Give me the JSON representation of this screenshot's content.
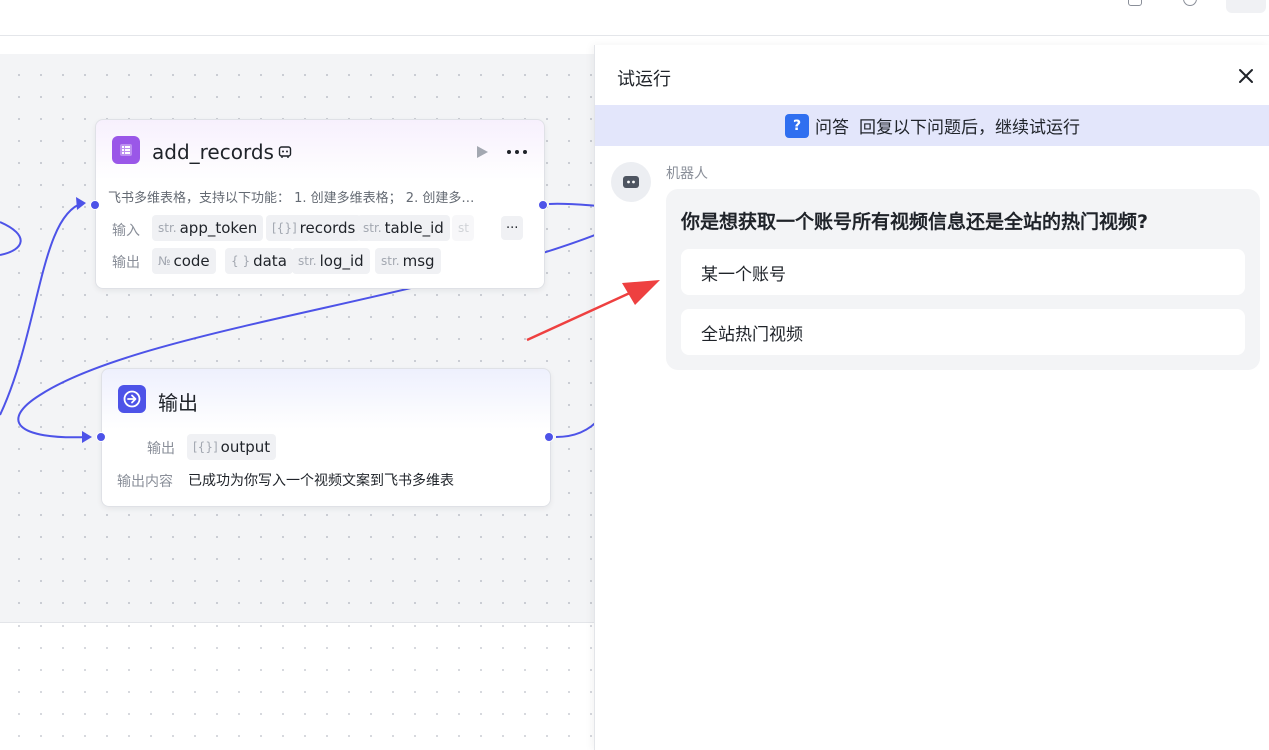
{
  "canvas": {
    "node_add_records": {
      "title": "add_records",
      "description": "飞书多维表格，支持以下功能： 1. 创建多维表格； 2. 创建多…",
      "input_label": "输入",
      "output_label": "输出",
      "inputs": [
        {
          "type": "str.",
          "name": "app_token"
        },
        {
          "type": "[{}]",
          "name": "records"
        },
        {
          "type": "str.",
          "name": "table_id"
        },
        {
          "type": "st",
          "name": ""
        }
      ],
      "outputs": [
        {
          "type": "№",
          "name": "code"
        },
        {
          "type": "{ }",
          "name": "data"
        },
        {
          "type": "str.",
          "name": "log_id"
        },
        {
          "type": "str.",
          "name": "msg"
        }
      ],
      "more_inputs": "···"
    },
    "node_output": {
      "title": "输出",
      "output_label": "输出",
      "output_var": {
        "type": "[{}]",
        "name": "output"
      },
      "content_label": "输出内容",
      "content_value": "已成功为你写入一个视频文案到飞书多维表"
    },
    "edge_color": "#4d53e8"
  },
  "panel": {
    "title": "试运行",
    "banner": {
      "tag": "问答",
      "text": "回复以下问题后，继续试运行",
      "icon": "question-icon"
    },
    "message": {
      "sender": "机器人",
      "question": "你是想获取一个账号所有视频信息还是全站的热门视频?",
      "options": [
        "某一个账号",
        "全站热门视频"
      ]
    }
  },
  "annotation": {
    "arrow_color": "#ee4040"
  }
}
